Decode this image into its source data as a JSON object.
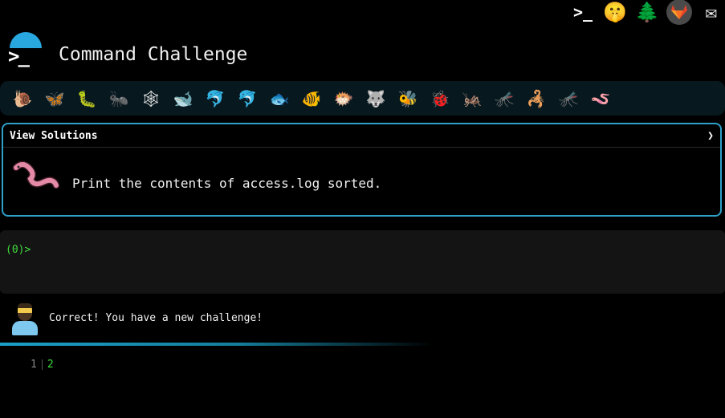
{
  "header": {
    "title": "Command Challenge",
    "top_icons": [
      "terminal-icon",
      "shushing-face-icon",
      "evergreen-tree-icon",
      "gitlab-icon",
      "envelope-icon"
    ],
    "term_glyph": ">_",
    "shush_glyph": "🤫",
    "tree_glyph": "🌲",
    "mail_glyph": "✉"
  },
  "emoji_bar": [
    "🐌",
    "🦋",
    "🐛",
    "🐜",
    "🕸",
    "🐋",
    "🐬",
    "🐬",
    "🐟",
    "🐠",
    "🐡",
    "🐺",
    "🐝",
    "🐞",
    "🦗",
    "🦟",
    "🦂",
    "🦟",
    "🪱"
  ],
  "challenge": {
    "header_label": "View Solutions",
    "chevron": "❯",
    "text": "Print the contents of access.log sorted."
  },
  "terminal": {
    "prompt": "(0)>"
  },
  "feedback": {
    "message": "Correct! You have a new challenge!"
  },
  "history": {
    "numbers": [
      "1",
      "2"
    ]
  },
  "colors": {
    "accent": "#2ea0c8",
    "prompt_green": "#3ddc3d",
    "panel_bg": "#07181f",
    "terminal_bg": "#141414"
  }
}
